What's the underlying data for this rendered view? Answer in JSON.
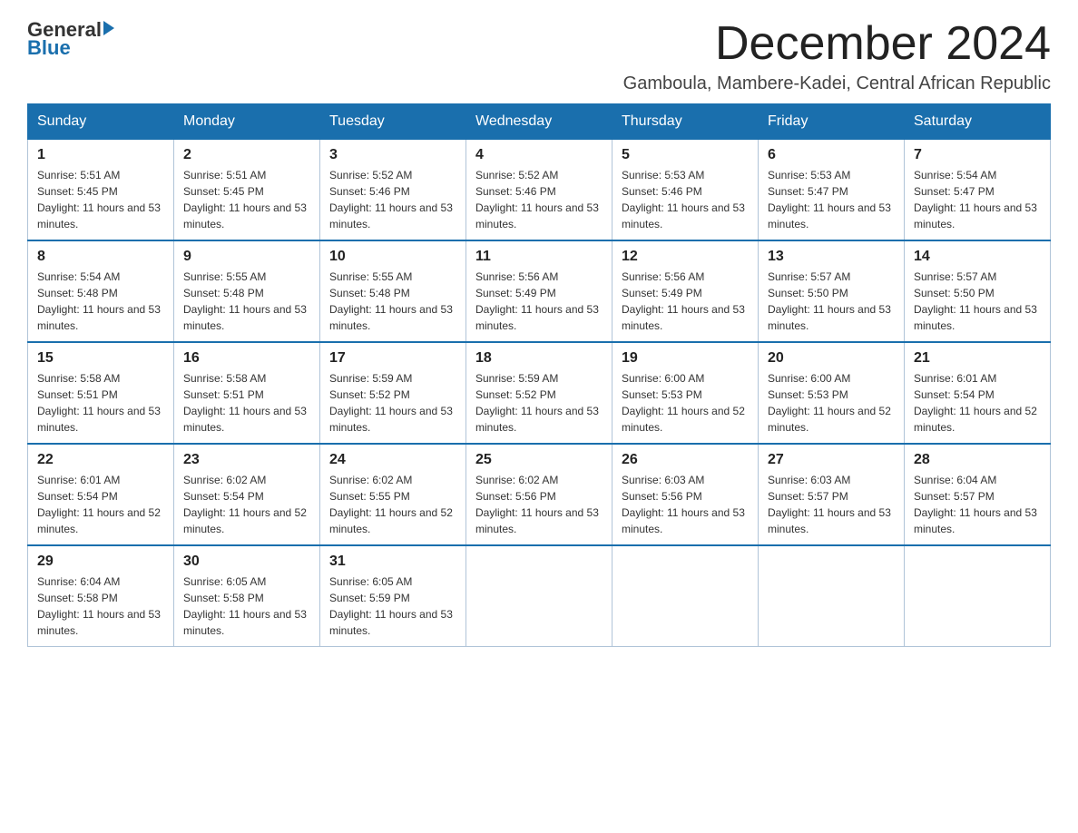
{
  "logo": {
    "text_general": "General",
    "text_blue": "Blue"
  },
  "header": {
    "month": "December 2024",
    "location": "Gamboula, Mambere-Kadei, Central African Republic"
  },
  "days_of_week": [
    "Sunday",
    "Monday",
    "Tuesday",
    "Wednesday",
    "Thursday",
    "Friday",
    "Saturday"
  ],
  "weeks": [
    [
      {
        "day": "1",
        "sunrise": "5:51 AM",
        "sunset": "5:45 PM",
        "daylight": "11 hours and 53 minutes."
      },
      {
        "day": "2",
        "sunrise": "5:51 AM",
        "sunset": "5:45 PM",
        "daylight": "11 hours and 53 minutes."
      },
      {
        "day": "3",
        "sunrise": "5:52 AM",
        "sunset": "5:46 PM",
        "daylight": "11 hours and 53 minutes."
      },
      {
        "day": "4",
        "sunrise": "5:52 AM",
        "sunset": "5:46 PM",
        "daylight": "11 hours and 53 minutes."
      },
      {
        "day": "5",
        "sunrise": "5:53 AM",
        "sunset": "5:46 PM",
        "daylight": "11 hours and 53 minutes."
      },
      {
        "day": "6",
        "sunrise": "5:53 AM",
        "sunset": "5:47 PM",
        "daylight": "11 hours and 53 minutes."
      },
      {
        "day": "7",
        "sunrise": "5:54 AM",
        "sunset": "5:47 PM",
        "daylight": "11 hours and 53 minutes."
      }
    ],
    [
      {
        "day": "8",
        "sunrise": "5:54 AM",
        "sunset": "5:48 PM",
        "daylight": "11 hours and 53 minutes."
      },
      {
        "day": "9",
        "sunrise": "5:55 AM",
        "sunset": "5:48 PM",
        "daylight": "11 hours and 53 minutes."
      },
      {
        "day": "10",
        "sunrise": "5:55 AM",
        "sunset": "5:48 PM",
        "daylight": "11 hours and 53 minutes."
      },
      {
        "day": "11",
        "sunrise": "5:56 AM",
        "sunset": "5:49 PM",
        "daylight": "11 hours and 53 minutes."
      },
      {
        "day": "12",
        "sunrise": "5:56 AM",
        "sunset": "5:49 PM",
        "daylight": "11 hours and 53 minutes."
      },
      {
        "day": "13",
        "sunrise": "5:57 AM",
        "sunset": "5:50 PM",
        "daylight": "11 hours and 53 minutes."
      },
      {
        "day": "14",
        "sunrise": "5:57 AM",
        "sunset": "5:50 PM",
        "daylight": "11 hours and 53 minutes."
      }
    ],
    [
      {
        "day": "15",
        "sunrise": "5:58 AM",
        "sunset": "5:51 PM",
        "daylight": "11 hours and 53 minutes."
      },
      {
        "day": "16",
        "sunrise": "5:58 AM",
        "sunset": "5:51 PM",
        "daylight": "11 hours and 53 minutes."
      },
      {
        "day": "17",
        "sunrise": "5:59 AM",
        "sunset": "5:52 PM",
        "daylight": "11 hours and 53 minutes."
      },
      {
        "day": "18",
        "sunrise": "5:59 AM",
        "sunset": "5:52 PM",
        "daylight": "11 hours and 53 minutes."
      },
      {
        "day": "19",
        "sunrise": "6:00 AM",
        "sunset": "5:53 PM",
        "daylight": "11 hours and 52 minutes."
      },
      {
        "day": "20",
        "sunrise": "6:00 AM",
        "sunset": "5:53 PM",
        "daylight": "11 hours and 52 minutes."
      },
      {
        "day": "21",
        "sunrise": "6:01 AM",
        "sunset": "5:54 PM",
        "daylight": "11 hours and 52 minutes."
      }
    ],
    [
      {
        "day": "22",
        "sunrise": "6:01 AM",
        "sunset": "5:54 PM",
        "daylight": "11 hours and 52 minutes."
      },
      {
        "day": "23",
        "sunrise": "6:02 AM",
        "sunset": "5:54 PM",
        "daylight": "11 hours and 52 minutes."
      },
      {
        "day": "24",
        "sunrise": "6:02 AM",
        "sunset": "5:55 PM",
        "daylight": "11 hours and 52 minutes."
      },
      {
        "day": "25",
        "sunrise": "6:02 AM",
        "sunset": "5:56 PM",
        "daylight": "11 hours and 53 minutes."
      },
      {
        "day": "26",
        "sunrise": "6:03 AM",
        "sunset": "5:56 PM",
        "daylight": "11 hours and 53 minutes."
      },
      {
        "day": "27",
        "sunrise": "6:03 AM",
        "sunset": "5:57 PM",
        "daylight": "11 hours and 53 minutes."
      },
      {
        "day": "28",
        "sunrise": "6:04 AM",
        "sunset": "5:57 PM",
        "daylight": "11 hours and 53 minutes."
      }
    ],
    [
      {
        "day": "29",
        "sunrise": "6:04 AM",
        "sunset": "5:58 PM",
        "daylight": "11 hours and 53 minutes."
      },
      {
        "day": "30",
        "sunrise": "6:05 AM",
        "sunset": "5:58 PM",
        "daylight": "11 hours and 53 minutes."
      },
      {
        "day": "31",
        "sunrise": "6:05 AM",
        "sunset": "5:59 PM",
        "daylight": "11 hours and 53 minutes."
      },
      null,
      null,
      null,
      null
    ]
  ]
}
